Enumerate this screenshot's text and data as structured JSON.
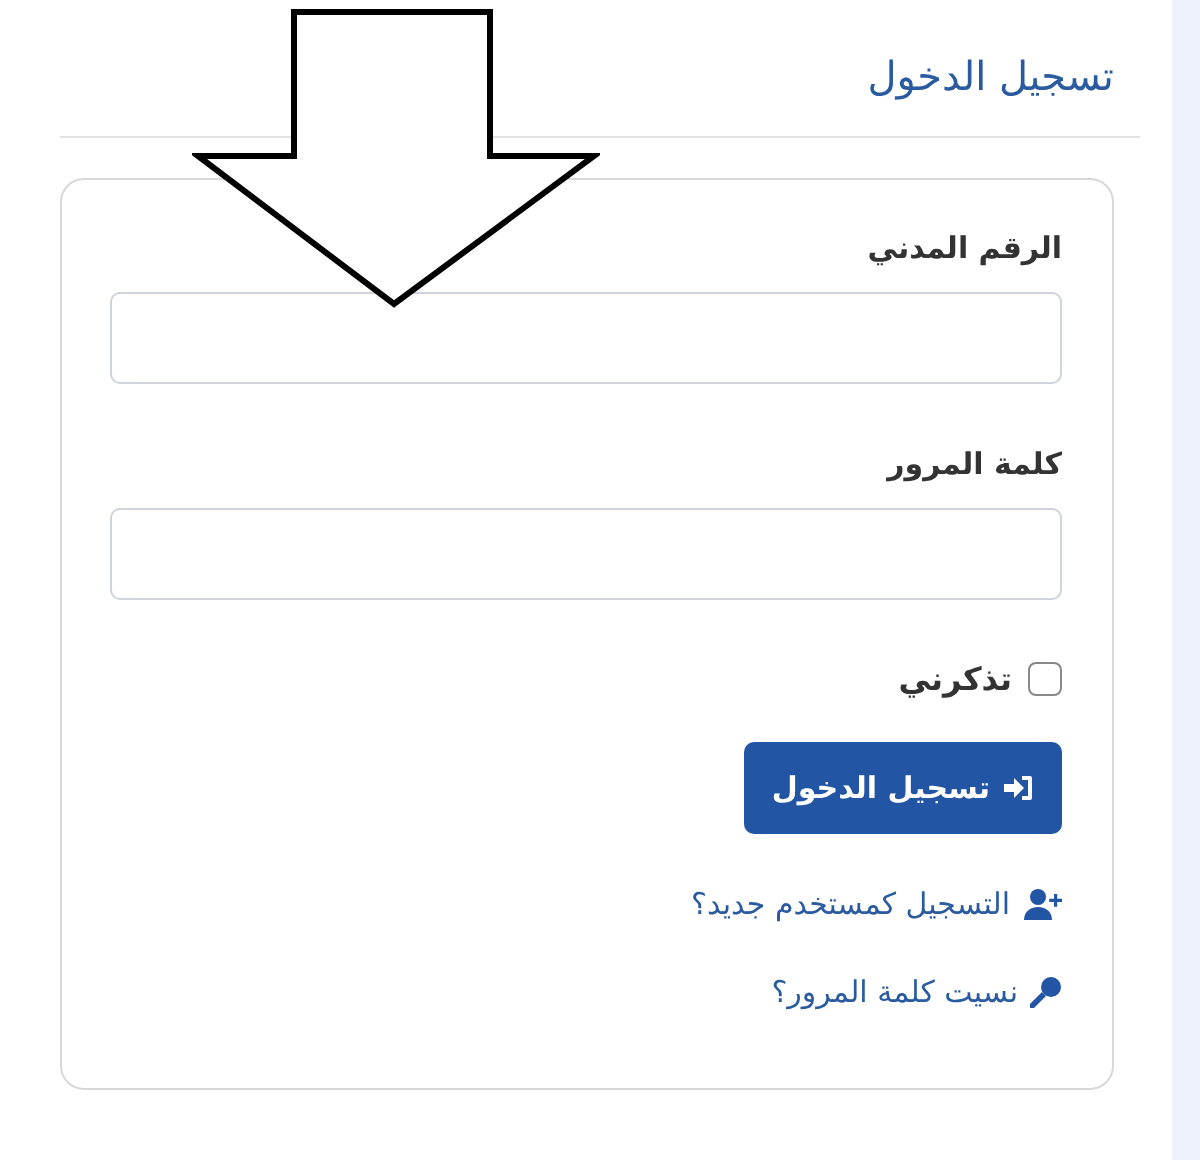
{
  "title": "تسجيل الدخول",
  "fields": [
    {
      "label": "الرقم المدني"
    },
    {
      "label": "كلمة المرور"
    }
  ],
  "remember": {
    "label": "تذكرني",
    "checked": false
  },
  "submit": {
    "label": "تسجيل الدخول"
  },
  "links": [
    {
      "kind": "register",
      "label": "التسجيل كمستخدم جديد؟"
    },
    {
      "kind": "forgot",
      "label": "نسيت كلمة المرور؟"
    }
  ]
}
